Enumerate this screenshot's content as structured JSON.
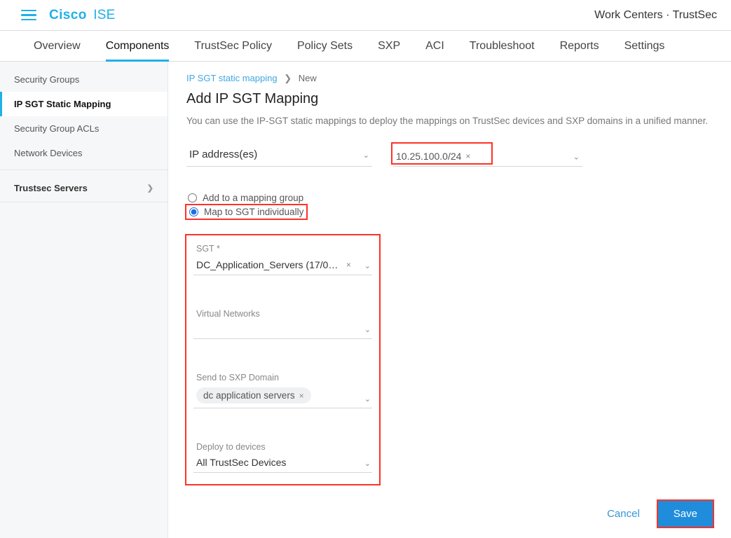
{
  "header": {
    "brand_cisco": "Cisco",
    "brand_ise": "ISE",
    "context": "Work Centers · TrustSec"
  },
  "tabs": [
    {
      "label": "Overview"
    },
    {
      "label": "Components",
      "active": true
    },
    {
      "label": "TrustSec Policy"
    },
    {
      "label": "Policy Sets"
    },
    {
      "label": "SXP"
    },
    {
      "label": "ACI"
    },
    {
      "label": "Troubleshoot"
    },
    {
      "label": "Reports"
    },
    {
      "label": "Settings"
    }
  ],
  "sidebar": {
    "items": [
      {
        "label": "Security Groups"
      },
      {
        "label": "IP SGT Static Mapping",
        "selected": true
      },
      {
        "label": "Security Group ACLs"
      },
      {
        "label": "Network Devices"
      }
    ],
    "section": {
      "label": "Trustsec Servers"
    }
  },
  "breadcrumb": {
    "link": "IP SGT static mapping",
    "current": "New"
  },
  "page": {
    "title": "Add IP SGT Mapping",
    "description": "You can use the IP-SGT static mappings to deploy the mappings on TrustSec devices and SXP domains in a unified manner."
  },
  "ip_row": {
    "select_label": "IP address(es)",
    "chip_value": "10.25.100.0/24"
  },
  "radios": {
    "group_label": "Add to a mapping group",
    "individual_label": "Map to SGT individually"
  },
  "form": {
    "sgt": {
      "label": "SGT *",
      "value": "DC_Application_Servers (17/00…"
    },
    "vnet": {
      "label": "Virtual Networks"
    },
    "sxp": {
      "label": "Send to SXP Domain",
      "pill": "dc application servers"
    },
    "deploy": {
      "label": "Deploy to devices",
      "value": "All TrustSec Devices"
    }
  },
  "buttons": {
    "cancel": "Cancel",
    "save": "Save"
  }
}
